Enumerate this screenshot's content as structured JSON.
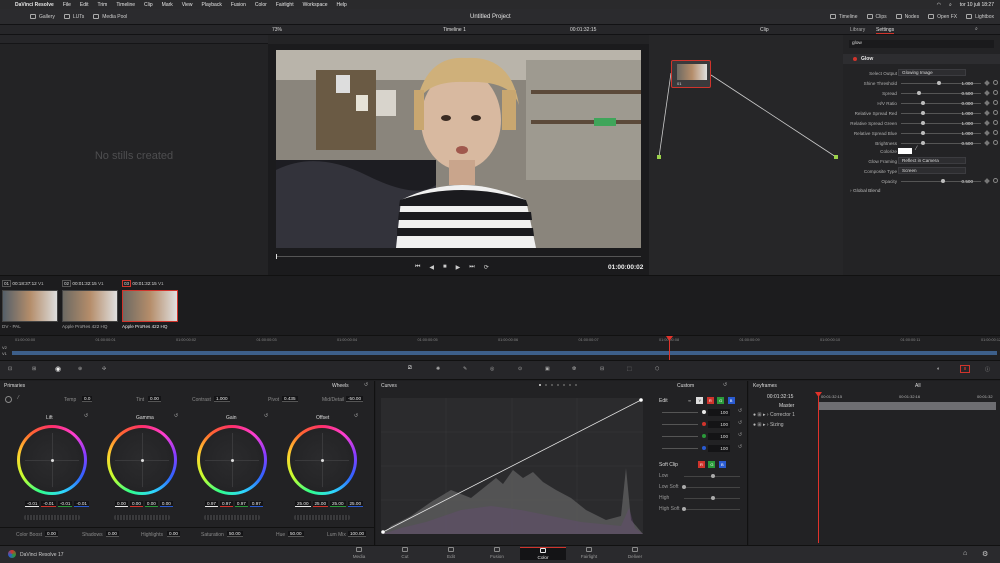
{
  "mac_menu": {
    "apple": "",
    "app": "DaVinci Resolve",
    "items": [
      "File",
      "Edit",
      "Trim",
      "Timeline",
      "Clip",
      "Mark",
      "View",
      "Playback",
      "Fusion",
      "Color",
      "Fairlight",
      "Workspace",
      "Help"
    ],
    "clock": "tor 10 juli  18:27"
  },
  "toolbar": {
    "gallery": "Gallery",
    "luts": "LUTs",
    "media_pool": "Media Pool",
    "project_title": "Untitled Project",
    "timeline": "Timeline",
    "clips": "Clips",
    "nodes": "Nodes",
    "open_fx": "Open FX",
    "lightbox": "Lightbox"
  },
  "viewer": {
    "zoom": "73%",
    "timeline_name": "Timeline 1",
    "timecode_top": "00:01:32:15",
    "timecode_bottom": "01:00:00:02"
  },
  "gallery": {
    "empty_text": "No stills created"
  },
  "node_editor": {
    "clip_label": "Clip",
    "node_label": "01"
  },
  "inspector": {
    "tab_library": "Library",
    "tab_settings": "Settings",
    "search_value": "glow",
    "section_title": "Glow",
    "select_output_label": "Select Output",
    "select_output_value": "Glowing Image",
    "params": [
      {
        "label": "Shine Threshold",
        "value": "1.000",
        "pos": 0.9
      },
      {
        "label": "Spread",
        "value": "0.500",
        "pos": 0.4
      },
      {
        "label": "H/V Ratio",
        "value": "0.000",
        "pos": 0.5
      },
      {
        "label": "Relative Spread Red",
        "value": "1.000",
        "pos": 0.5
      },
      {
        "label": "Relative Spread Green",
        "value": "1.000",
        "pos": 0.5
      },
      {
        "label": "Relative Spread Blue",
        "value": "1.000",
        "pos": 0.5
      },
      {
        "label": "Brightness",
        "value": "0.500",
        "pos": 0.5
      }
    ],
    "colorize_label": "Colorize",
    "glow_framing_label": "Glow Framing",
    "glow_framing_value": "Reflect in Camera",
    "composite_type_label": "Composite Type",
    "composite_type_value": "Screen",
    "opacity_label": "Opacity",
    "opacity_value": "0.500",
    "global_blend": "Global Blend"
  },
  "clips": [
    {
      "num": "01",
      "tc": "00:18:37:12",
      "track": "V1",
      "name": "DV - PAL"
    },
    {
      "num": "02",
      "tc": "00:01:32:15",
      "track": "V1",
      "name": "Apple ProRes 422 HQ"
    },
    {
      "num": "03",
      "tc": "00:01:32:15",
      "track": "V1",
      "name": "Apple ProRes 422 HQ"
    }
  ],
  "ruler": [
    "01:00:00:00",
    "01:00:00:01",
    "01:00:00:02",
    "01:00:00:03",
    "01:00:00:04",
    "01:00:00:05",
    "01:00:00:06",
    "01:00:00:07",
    "01:00:00:08",
    "01:00:00:09",
    "01:00:00:10",
    "01:00:00:11",
    "01:00:00:12"
  ],
  "track_labels": [
    "V2",
    "V1"
  ],
  "primaries": {
    "title": "Primaries",
    "mode": "Wheels",
    "temp_label": "Temp",
    "temp_value": "0.0",
    "tint_label": "Tint",
    "tint_value": "0.00",
    "contrast_label": "Contrast",
    "contrast_value": "1.000",
    "pivot_label": "Pivot",
    "pivot_value": "0.435",
    "middetail_label": "Mid/Detail",
    "middetail_value": "-50.00",
    "wheels": [
      {
        "name": "Lift",
        "vals": [
          "-0.01",
          "-0.01",
          "-0.01",
          "-0.01"
        ]
      },
      {
        "name": "Gamma",
        "vals": [
          "0.00",
          "0.00",
          "0.00",
          "0.00"
        ]
      },
      {
        "name": "Gain",
        "vals": [
          "0.97",
          "0.97",
          "0.97",
          "0.97"
        ]
      },
      {
        "name": "Offset",
        "vals": [
          "25.00",
          "25.00",
          "25.00",
          "25.00"
        ]
      }
    ],
    "colorboost_label": "Color Boost",
    "colorboost_value": "0.00",
    "shadows_label": "Shadows",
    "shadows_value": "0.00",
    "highlights_label": "Highlights",
    "highlights_value": "0.00",
    "saturation_label": "Saturation",
    "saturation_value": "50.00",
    "hue_label": "Hue",
    "hue_value": "50.00",
    "lummix_label": "Lum Mix",
    "lummix_value": "100.00"
  },
  "curves": {
    "title": "Curves",
    "mode": "Custom"
  },
  "edit": {
    "title": "Edit",
    "values": [
      "100",
      "100",
      "100",
      "100"
    ],
    "softclip_title": "Soft Clip",
    "softclip_rows": [
      "Low",
      "Low Soft",
      "High",
      "High Soft"
    ]
  },
  "keyframes": {
    "title": "Keyframes",
    "filter": "All",
    "tc": "00:01:32:15",
    "tc2": "00:01:32:15",
    "tc3": "00:01:32:16",
    "tc4": "00:01:32",
    "master": "Master",
    "tracks": [
      "Corrector 1",
      "Sizing"
    ]
  },
  "pages": {
    "brand": "DaVinci Resolve 17",
    "tabs": [
      "Media",
      "Cut",
      "Edit",
      "Fusion",
      "Color",
      "Fairlight",
      "Deliver"
    ]
  },
  "colors": {
    "accent": "#d0342c",
    "bg": "#1e1e20"
  }
}
